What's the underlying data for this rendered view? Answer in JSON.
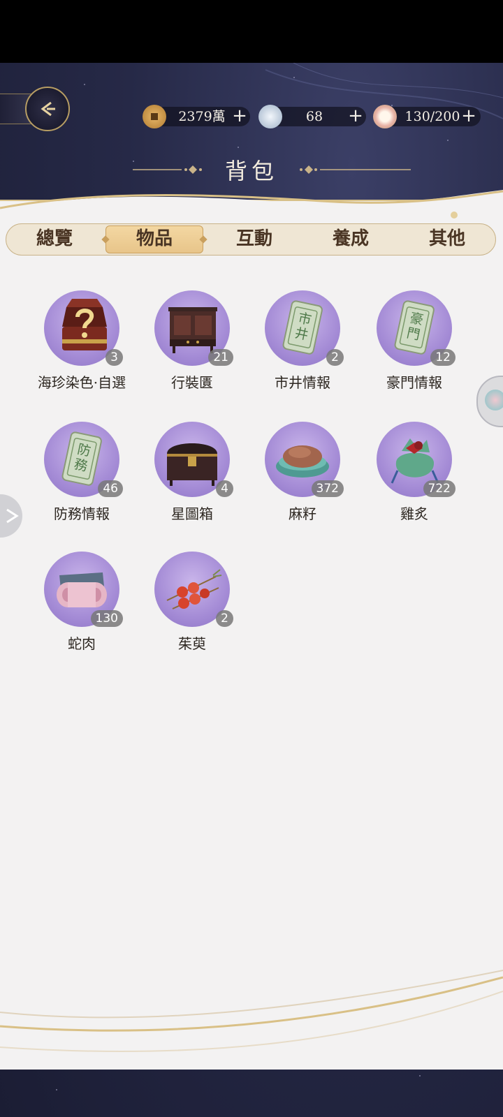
{
  "header": {
    "title": "背包",
    "currencies": [
      {
        "name": "coin",
        "icon": "copper-coin-icon",
        "value": "2379萬"
      },
      {
        "name": "jade",
        "icon": "silver-pearl-icon",
        "value": "68"
      },
      {
        "name": "stamina",
        "icon": "food-bowl-icon",
        "value": "130/200"
      }
    ]
  },
  "tabs": [
    {
      "label": "總覽",
      "active": false
    },
    {
      "label": "物品",
      "active": true
    },
    {
      "label": "互動",
      "active": false
    },
    {
      "label": "養成",
      "active": false
    },
    {
      "label": "其他",
      "active": false
    }
  ],
  "items": [
    {
      "name": "海珍染色·自選",
      "count": "3",
      "icon": "mystery-chest-icon"
    },
    {
      "name": "行裝匱",
      "count": "21",
      "icon": "cabinet-icon"
    },
    {
      "name": "市井情報",
      "count": "2",
      "icon": "jade-tablet-icon",
      "tablet_text": "市井"
    },
    {
      "name": "豪門情報",
      "count": "12",
      "icon": "jade-tablet-icon",
      "tablet_text": "豪門"
    },
    {
      "name": "防務情報",
      "count": "46",
      "icon": "jade-tablet-icon",
      "tablet_text": "防務"
    },
    {
      "name": "星圖箱",
      "count": "4",
      "icon": "lacquer-chest-icon"
    },
    {
      "name": "麻籽",
      "count": "372",
      "icon": "seed-bowl-icon"
    },
    {
      "name": "雞炙",
      "count": "722",
      "icon": "food-pouch-icon"
    },
    {
      "name": "蛇肉",
      "count": "130",
      "icon": "meat-roll-icon"
    },
    {
      "name": "茱萸",
      "count": "2",
      "icon": "berry-skewer-icon"
    }
  ],
  "colors": {
    "accent": "#c99f5d",
    "panel": "#f3f2f2",
    "tab_text": "#4a3524",
    "item_circle": "#a58cd6"
  }
}
